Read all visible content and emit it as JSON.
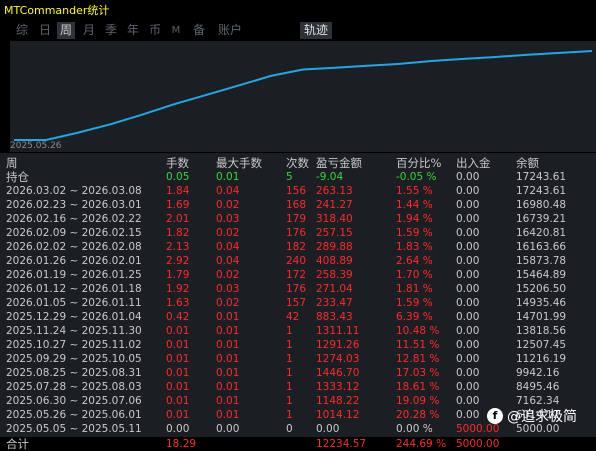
{
  "window": {
    "title": "MTCommander统计"
  },
  "tabs": [
    {
      "label": "综",
      "active": false
    },
    {
      "label": "日",
      "active": false
    },
    {
      "label": "周",
      "active": true
    },
    {
      "label": "月",
      "active": false
    },
    {
      "label": "季",
      "active": false
    },
    {
      "label": "年",
      "active": false
    },
    {
      "label": "币",
      "active": false
    },
    {
      "label": "M",
      "active": false
    },
    {
      "label": "备",
      "active": false
    },
    {
      "label": "账户",
      "active": false
    }
  ],
  "track_tab": {
    "label": "轨迹"
  },
  "chart": {
    "start_date_label": "2025.05.26",
    "line_color": "#1ea8e8",
    "background": "#1b1f24"
  },
  "chart_data": {
    "type": "line",
    "series": [
      {
        "values": [
          5000.0,
          5000.0,
          6014.12,
          7162.34,
          8495.46,
          9942.16,
          11216.19,
          12507.45,
          13818.56,
          14701.99,
          14935.46,
          15206.5,
          15464.89,
          15873.78,
          16163.66,
          16420.81,
          16739.21,
          16980.48,
          17243.61
        ]
      }
    ],
    "color": "#1ea8e8"
  },
  "table": {
    "headers": [
      "周",
      "手数",
      "最大手数",
      "次数",
      "盈亏金额",
      "百分比%",
      "出入金",
      "余额"
    ],
    "holding": {
      "label": "持仓",
      "lots": "0.05",
      "max_lots": "0.01",
      "count": "5",
      "pnl": "-9.04",
      "pct": "-0.05 %",
      "flow": "0.00",
      "balance": "17243.61"
    },
    "rows": [
      [
        "2026.03.02 ~ 2026.03.08",
        "1.84",
        "0.04",
        "156",
        "263.13",
        "1.55 %",
        "0.00",
        "17243.61"
      ],
      [
        "2026.02.23 ~ 2026.03.01",
        "1.69",
        "0.02",
        "168",
        "241.27",
        "1.44 %",
        "0.00",
        "16980.48"
      ],
      [
        "2026.02.16 ~ 2026.02.22",
        "2.01",
        "0.03",
        "179",
        "318.40",
        "1.94 %",
        "0.00",
        "16739.21"
      ],
      [
        "2026.02.09 ~ 2026.02.15",
        "1.82",
        "0.02",
        "176",
        "257.15",
        "1.59 %",
        "0.00",
        "16420.81"
      ],
      [
        "2026.02.02 ~ 2026.02.08",
        "2.13",
        "0.04",
        "182",
        "289.88",
        "1.83 %",
        "0.00",
        "16163.66"
      ],
      [
        "2026.01.26 ~ 2026.02.01",
        "2.92",
        "0.04",
        "240",
        "408.89",
        "2.64 %",
        "0.00",
        "15873.78"
      ],
      [
        "2026.01.19 ~ 2026.01.25",
        "1.79",
        "0.02",
        "172",
        "258.39",
        "1.70 %",
        "0.00",
        "15464.89"
      ],
      [
        "2026.01.12 ~ 2026.01.18",
        "1.92",
        "0.03",
        "176",
        "271.04",
        "1.81 %",
        "0.00",
        "15206.50"
      ],
      [
        "2026.01.05 ~ 2026.01.11",
        "1.63",
        "0.02",
        "157",
        "233.47",
        "1.59 %",
        "0.00",
        "14935.46"
      ],
      [
        "2025.12.29 ~ 2026.01.04",
        "0.42",
        "0.01",
        "42",
        "883.43",
        "6.39 %",
        "0.00",
        "14701.99"
      ],
      [
        "2025.11.24 ~ 2025.11.30",
        "0.01",
        "0.01",
        "1",
        "1311.11",
        "10.48 %",
        "0.00",
        "13818.56"
      ],
      [
        "2025.10.27 ~ 2025.11.02",
        "0.01",
        "0.01",
        "1",
        "1291.26",
        "11.51 %",
        "0.00",
        "12507.45"
      ],
      [
        "2025.09.29 ~ 2025.10.05",
        "0.01",
        "0.01",
        "1",
        "1274.03",
        "12.81 %",
        "0.00",
        "11216.19"
      ],
      [
        "2025.08.25 ~ 2025.08.31",
        "0.01",
        "0.01",
        "1",
        "1446.70",
        "17.03 %",
        "0.00",
        "9942.16"
      ],
      [
        "2025.07.28 ~ 2025.08.03",
        "0.01",
        "0.01",
        "1",
        "1333.12",
        "18.61 %",
        "0.00",
        "8495.46"
      ],
      [
        "2025.06.30 ~ 2025.07.06",
        "0.01",
        "0.01",
        "1",
        "1148.22",
        "19.09 %",
        "0.00",
        "7162.34"
      ],
      [
        "2025.05.26 ~ 2025.06.01",
        "0.01",
        "0.01",
        "1",
        "1014.12",
        "20.28 %",
        "0.00",
        "6014.12"
      ],
      [
        "2025.05.05 ~ 2025.05.11",
        "0.00",
        "0.00",
        "0",
        "0.00",
        "0.00 %",
        "5000.00",
        "5000.00"
      ]
    ],
    "summary": {
      "label": "合计",
      "lots": "18.29",
      "pnl": "12234.57",
      "pct": "244.69 %",
      "flow": "5000.00"
    }
  },
  "watermark": {
    "text": "@追求极简"
  }
}
